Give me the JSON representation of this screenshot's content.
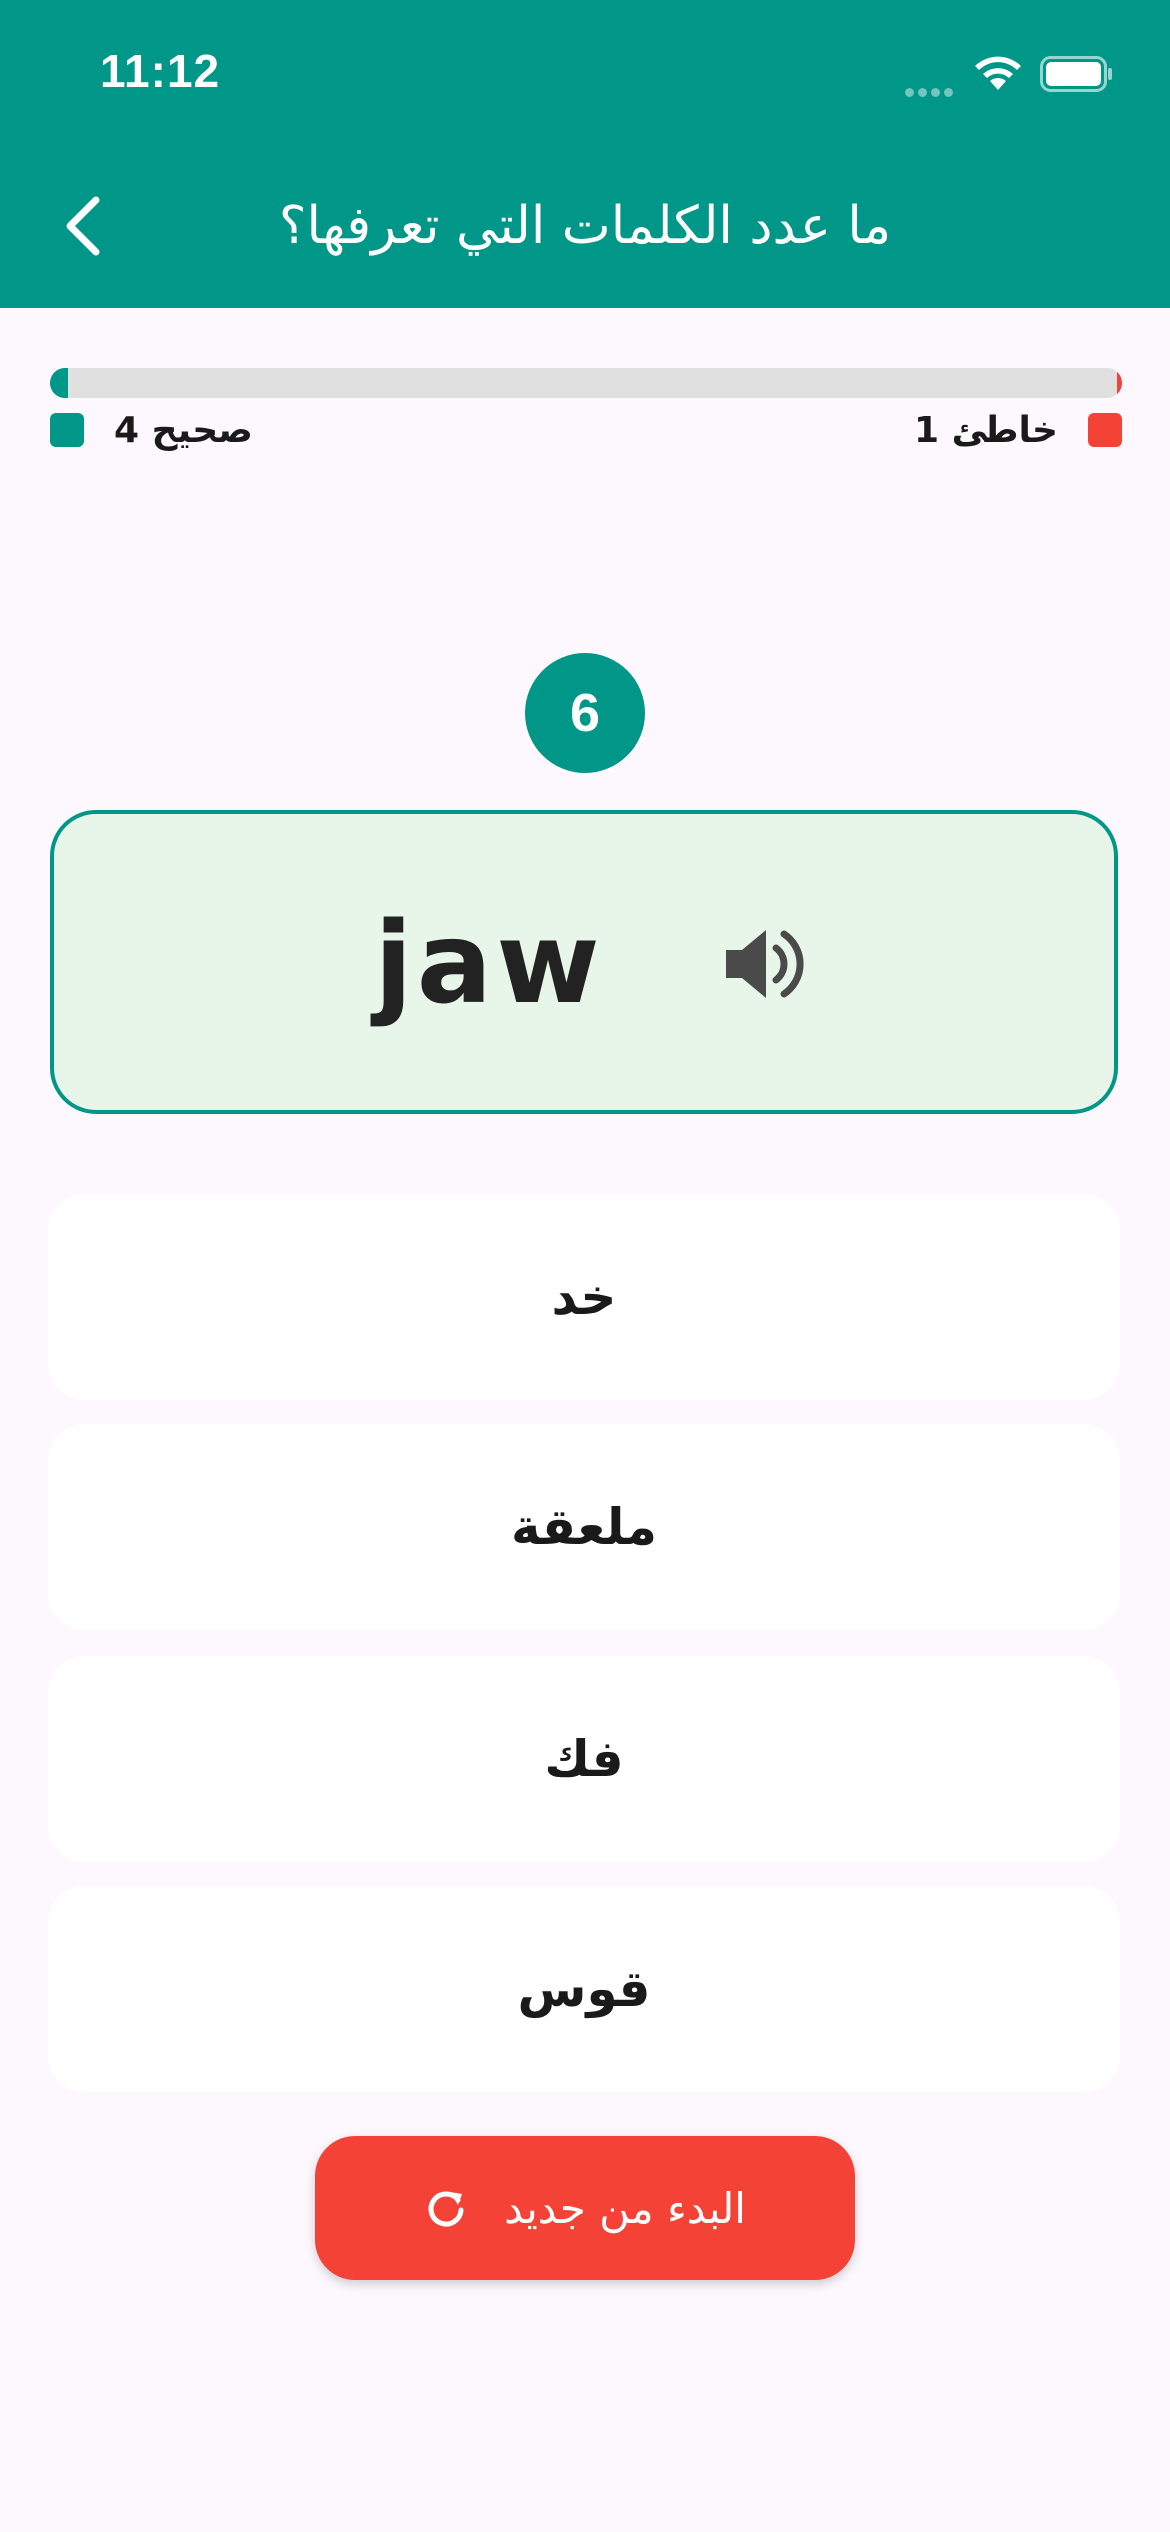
{
  "status_bar": {
    "time": "11:12"
  },
  "header": {
    "title": "ما عدد الكلمات التي تعرفها؟",
    "back_icon": "chevron-left-icon"
  },
  "progress": {
    "correct_fraction": 0.017,
    "wrong_fraction": 0.005,
    "correct_label": "صحيح 4",
    "wrong_label": "خاطئ 1",
    "correct_color": "#009688",
    "wrong_color": "#f44336",
    "track_color": "#e0e0e0"
  },
  "question": {
    "number": "6",
    "word": "jaw",
    "audio_icon": "speaker-icon"
  },
  "options": [
    "خد",
    "ملعقة",
    "فك",
    "قوس"
  ],
  "restart": {
    "label": "البدء من جديد",
    "icon": "refresh-icon"
  },
  "colors": {
    "primary": "#009688",
    "danger": "#f44336",
    "card_bg": "#e8f5e9",
    "page_bg": "#fdf7fe"
  }
}
